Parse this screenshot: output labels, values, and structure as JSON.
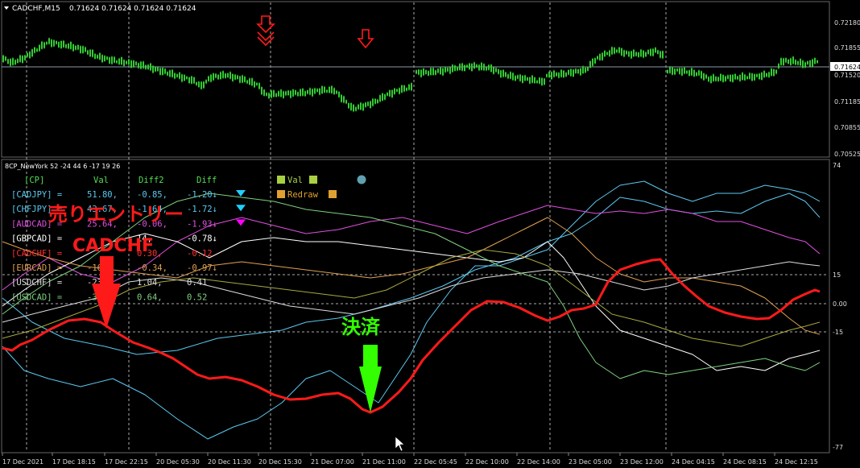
{
  "main_header": {
    "menu_icon": "triangle-down-icon",
    "symbol": "CADCHF,M15",
    "ohlc": "0.71624 0.71624 0.71624 0.71624"
  },
  "main_price_labels": [
    "0.72180",
    "0.71855",
    "0.71624",
    "0.71520",
    "0.71185",
    "0.70855",
    "0.70525"
  ],
  "ind_header": "8CP_NewYork 52 -24 44 6 -17 19 26",
  "ind_scale": {
    "top": "74",
    "p15": "15",
    "zero": "0.00",
    "m15": "-15",
    "bottom": "-77"
  },
  "table": {
    "headers": [
      "[CP]",
      "Val",
      "Diff2",
      "Diff"
    ],
    "rows": [
      {
        "pair": "[CADJPY]",
        "val": "51.80,",
        "diff2": "-0.85,",
        "diff": "-1.20↓",
        "color": "#5bc8f0",
        "tri": "down",
        "tri_color": "#20d0ff"
      },
      {
        "pair": "[CHFJPY]",
        "val": "43.67,",
        "diff2": "-1.64,",
        "diff": "-1.72↓",
        "color": "#5bc8f0",
        "tri": "down",
        "tri_color": "#20d0ff"
      },
      {
        "pair": "[AUDCAD]",
        "val": "25.64,",
        "diff2": "-0.06,",
        "diff": "-1.93↓",
        "color": "#e050e0",
        "tri": "down",
        "tri_color": "#ff00ff"
      },
      {
        "pair": "[GBPCAD]",
        "val": "",
        "diff2": "14,",
        "diff": "-0.78↓",
        "color": "#ffffff",
        "tri": "",
        "tri_color": ""
      },
      {
        "pair": "[CADCHF]",
        "val": "",
        "diff2": "0.30,",
        "diff": "-0.12",
        "color": "#ff3030",
        "tri": "",
        "tri_color": ""
      },
      {
        "pair": "[EURCAD]",
        "val": "-16.",
        "diff2": "-0.34,",
        "diff": "-0.97↓",
        "color": "#e0a050",
        "tri": "",
        "tri_color": ""
      },
      {
        "pair": "[USDCHF]",
        "val": "-23.",
        "diff2": "1.04,",
        "diff": "0.41",
        "color": "#dddddd",
        "tri": "",
        "tri_color": ""
      },
      {
        "pair": "[USDCAD]",
        "val": "-31.",
        "diff2": "0.64,",
        "diff": "0.52",
        "color": "#7fd07f",
        "tri": "",
        "tri_color": ""
      }
    ]
  },
  "legend": [
    {
      "label": "Val",
      "color": "#a8d040"
    },
    {
      "label": "Redraw",
      "color": "#e0a030"
    }
  ],
  "legend_dot_color": "#60a0b0",
  "annotations": {
    "sell_line1": "売りエントリー",
    "sell_line2": "CADCHF",
    "close": "決済"
  },
  "x_labels": [
    "17 Dec 2021",
    "17 Dec 18:15",
    "17 Dec 22:15",
    "20 Dec 05:30",
    "20 Dec 11:30",
    "20 Dec 15:30",
    "21 Dec 07:00",
    "21 Dec 11:00",
    "22 Dec 05:45",
    "22 Dec 10:00",
    "22 Dec 14:00",
    "23 Dec 05:00",
    "23 Dec 12:00",
    "24 Dec 04:15",
    "24 Dec 08:15",
    "24 Dec 12:15"
  ],
  "colors": {
    "candle": "#33cc33",
    "cadchf_line": "#ff1a1a",
    "sell_arrow": "#ff1a1a",
    "close_arrow": "#33ff00",
    "grid": "#888888"
  }
}
